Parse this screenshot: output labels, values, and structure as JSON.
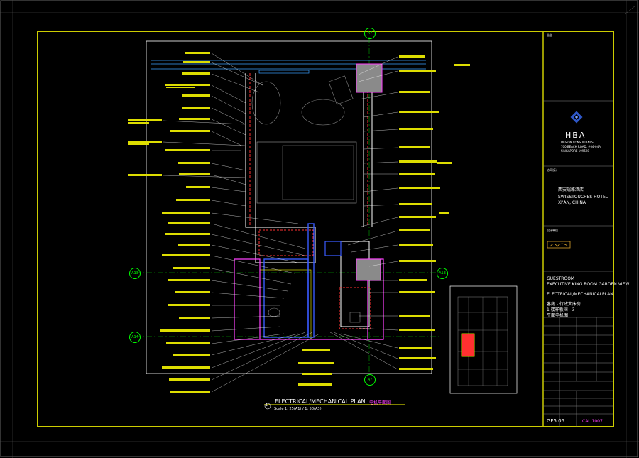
{
  "colors": {
    "frame": "#ffff00",
    "accent_blue": "#3a5bff",
    "accent_magenta": "#ff40ff",
    "grid_green": "#00ff00",
    "wall_red": "#ff3030"
  },
  "grid_labels": {
    "top": "A7",
    "bottom": "A7",
    "left_upper": "A13",
    "right_upper": "A13",
    "left_lower": "A14"
  },
  "plan": {
    "title": "ELECTRICAL/MECHANICAL PLAN",
    "scale": "Scale 1: 25(A1) / 1: 50(A3)",
    "title_cn": "电机平面图",
    "bubble": "1"
  },
  "title_block": {
    "client_label": "业主",
    "logo_text": "HBA",
    "firm_lines": [
      "DESIGN CONSULTANTS",
      "700 BEACH ROAD, #04-04A,",
      "SINGAPORE 199598"
    ],
    "project_cn": "西安瑞雅酒店",
    "project_en": [
      "SWISSTOUCHES HOTEL",
      "XI'AN, CHINA"
    ],
    "design_label": "设计单位",
    "partner_cn": "协同设计",
    "drawing_title": [
      "GUESTROOM",
      "EXECUTIVE KING ROOM GARDEN VIEW"
    ],
    "drawing_subtitle": "ELECTRICAL/MECHANICALPLAN",
    "drawing_cn": [
      "客房 - 行政大床房",
      "1 楼样板间 - 3",
      "平面电机图"
    ],
    "drawing_no": "GF5.05",
    "revision": "CAL  1007"
  }
}
